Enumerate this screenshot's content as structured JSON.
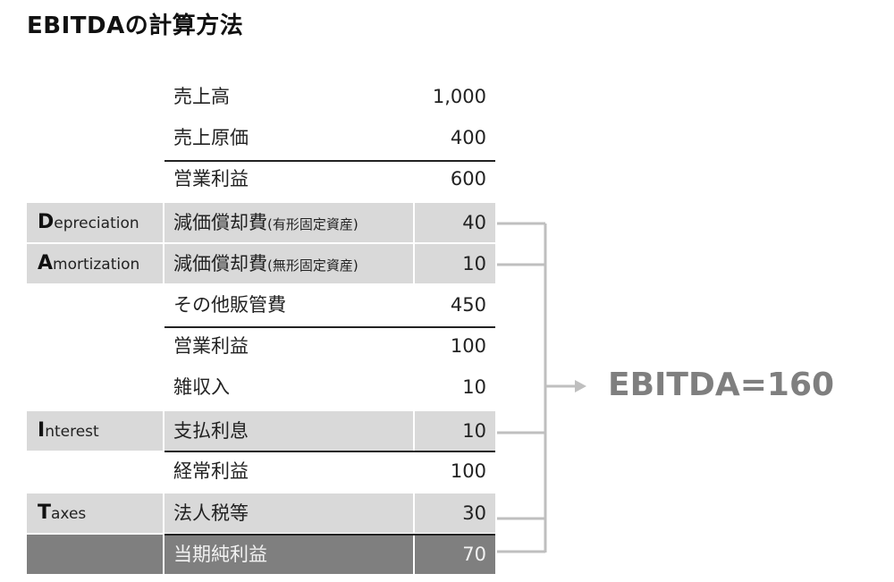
{
  "title": "EBITDAの計算方法",
  "rows": [
    {
      "left_initial": "",
      "left_rest": "",
      "label": "売上高",
      "label_suffix": "",
      "value": "1,000",
      "style": "plain"
    },
    {
      "left_initial": "",
      "left_rest": "",
      "label": "売上原価",
      "label_suffix": "",
      "value": "400",
      "style": "plain"
    },
    {
      "left_initial": "",
      "left_rest": "",
      "label": "営業利益",
      "label_suffix": "",
      "value": "600",
      "style": "plain"
    },
    {
      "left_initial": "D",
      "left_rest": "epreciation",
      "label": "減価償却費",
      "label_suffix": "(有形固定資産)",
      "value": "40",
      "style": "shade"
    },
    {
      "left_initial": "A",
      "left_rest": "mortization",
      "label": "減価償却費",
      "label_suffix": "(無形固定資産)",
      "value": "10",
      "style": "shade"
    },
    {
      "left_initial": "",
      "left_rest": "",
      "label": "その他販管費",
      "label_suffix": "",
      "value": "450",
      "style": "plain"
    },
    {
      "left_initial": "",
      "left_rest": "",
      "label": "営業利益",
      "label_suffix": "",
      "value": "100",
      "style": "plain"
    },
    {
      "left_initial": "",
      "left_rest": "",
      "label": "雑収入",
      "label_suffix": "",
      "value": "10",
      "style": "plain"
    },
    {
      "left_initial": "I",
      "left_rest": "nterest",
      "label": "支払利息",
      "label_suffix": "",
      "value": "10",
      "style": "shade"
    },
    {
      "left_initial": "",
      "left_rest": "",
      "label": "経常利益",
      "label_suffix": "",
      "value": "100",
      "style": "plain"
    },
    {
      "left_initial": "T",
      "left_rest": "axes",
      "label": "法人税等",
      "label_suffix": "",
      "value": "30",
      "style": "shade"
    },
    {
      "left_initial": "",
      "left_rest": "",
      "label": "当期純利益",
      "label_suffix": "",
      "value": "70",
      "style": "dark"
    }
  ],
  "result": "EBITDA=160",
  "colors": {
    "shade": "#d9d9d9",
    "dark": "#7f7f7f",
    "connector": "#bfbfbf",
    "result_text": "#7f7f7f"
  }
}
